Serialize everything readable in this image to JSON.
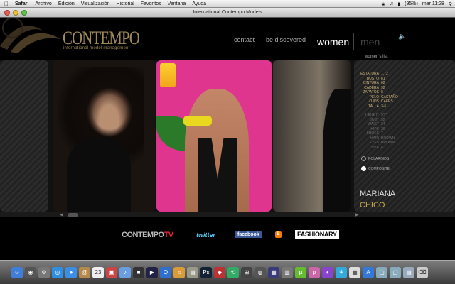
{
  "menubar": {
    "items": [
      "Safari",
      "Archivo",
      "Edición",
      "Visualización",
      "Historial",
      "Favoritos",
      "Ventana",
      "Ayuda"
    ],
    "battery": "(95%)",
    "clock": "mar 11:28"
  },
  "window": {
    "title": "International Contempo Models"
  },
  "site": {
    "logo": "CONTEMPO",
    "logo_sub": "international model management",
    "nav": {
      "contact": "contact",
      "discover": "be discovered",
      "women": "women",
      "men": "men"
    },
    "list_label": "women's list"
  },
  "model": {
    "stats_cm": [
      {
        "k": "ESTATURA",
        "v": "1.72"
      },
      {
        "k": "BUSTO",
        "v": "81"
      },
      {
        "k": "CINTURA",
        "v": "62"
      },
      {
        "k": "CADERA",
        "v": "92"
      },
      {
        "k": "ZAPATOS",
        "v": "8"
      },
      {
        "k": "PELO",
        "v": "CASTAÑO"
      },
      {
        "k": "OJOS",
        "v": "CAFES"
      },
      {
        "k": "TALLA",
        "v": "3-6"
      }
    ],
    "stats_in": [
      {
        "k": "HEIGHT",
        "v": "5'7\""
      },
      {
        "k": "BUST",
        "v": "32"
      },
      {
        "k": "WAIST",
        "v": "24"
      },
      {
        "k": "HIPS",
        "v": "36"
      },
      {
        "k": "SHOES",
        "v": "7"
      },
      {
        "k": "HAIR",
        "v": "BROWN"
      },
      {
        "k": "EYES",
        "v": "BROWN"
      },
      {
        "k": "SIZE",
        "v": "4"
      }
    ],
    "options": {
      "polaroid": "POLAROIDS",
      "composite": "COMPOSITE"
    },
    "first_name": "MARIANA",
    "last_name": "CHICO"
  },
  "footer": {
    "contempo": "CONTEMPO",
    "tv": "TV",
    "twitter": "twitter",
    "facebook": "facebook",
    "blogger": "B",
    "fashionary": "FASHIONARY"
  },
  "dock": {
    "icons": [
      {
        "name": "finder-icon",
        "color": "#3f7fd8",
        "glyph": "☺"
      },
      {
        "name": "dashboard-icon",
        "color": "#555",
        "glyph": "◉"
      },
      {
        "name": "system-preferences-icon",
        "color": "#777",
        "glyph": "⚙"
      },
      {
        "name": "safari-icon",
        "color": "#2f8fe0",
        "glyph": "◎"
      },
      {
        "name": "ichat-icon",
        "color": "#3a8ee6",
        "glyph": "●"
      },
      {
        "name": "address-book-icon",
        "color": "#b48a4a",
        "glyph": "@"
      },
      {
        "name": "ical-icon",
        "color": "#eee",
        "glyph": "23"
      },
      {
        "name": "iphoto-icon",
        "color": "#c44",
        "glyph": "▣"
      },
      {
        "name": "itunes-icon",
        "color": "#6b9ee0",
        "glyph": "♪"
      },
      {
        "name": "photo-booth-icon",
        "color": "#333",
        "glyph": "■"
      },
      {
        "name": "frontrow-icon",
        "color": "#224",
        "glyph": "▶"
      },
      {
        "name": "quicktime-icon",
        "color": "#2e6fd0",
        "glyph": "Q"
      },
      {
        "name": "garageband-icon",
        "color": "#d89c3a",
        "glyph": "♫"
      },
      {
        "name": "preview-icon",
        "color": "#998",
        "glyph": "▤"
      },
      {
        "name": "photoshop-icon",
        "color": "#123",
        "glyph": "Ps"
      },
      {
        "name": "app-icon",
        "color": "#b33",
        "glyph": "◆"
      },
      {
        "name": "time-machine-icon",
        "color": "#3a6",
        "glyph": "⟲"
      },
      {
        "name": "expose-icon",
        "color": "#444",
        "glyph": "⊞"
      },
      {
        "name": "aperture-icon",
        "color": "#555",
        "glyph": "◍"
      },
      {
        "name": "spaces-icon",
        "color": "#3a3a7a",
        "glyph": "▦"
      },
      {
        "name": "utility-icon",
        "color": "#777",
        "glyph": "▥"
      },
      {
        "name": "bittorrent-icon",
        "color": "#6b3",
        "glyph": "µ"
      },
      {
        "name": "vlc-icon",
        "color": "#c6a",
        "glyph": "p"
      },
      {
        "name": "widget-icon",
        "color": "#84c",
        "glyph": "◐"
      },
      {
        "name": "network-icon",
        "color": "#3ad",
        "glyph": "⚘"
      },
      {
        "name": "calculator-icon",
        "color": "#ddd",
        "glyph": "▦"
      },
      {
        "name": "app-store-icon",
        "color": "#3478d8",
        "glyph": "A"
      },
      {
        "name": "downloads-folder-icon",
        "color": "#8ab",
        "glyph": "▢"
      },
      {
        "name": "documents-folder-icon",
        "color": "#8ab",
        "glyph": "▢"
      },
      {
        "name": "stack-icon",
        "color": "#9ab",
        "glyph": "▤"
      },
      {
        "name": "trash-icon",
        "color": "#ccc",
        "glyph": "⌫"
      }
    ]
  },
  "colors": {
    "gold": "#c9a94e",
    "logo": "#a08a58",
    "pink": "#e0358f"
  }
}
